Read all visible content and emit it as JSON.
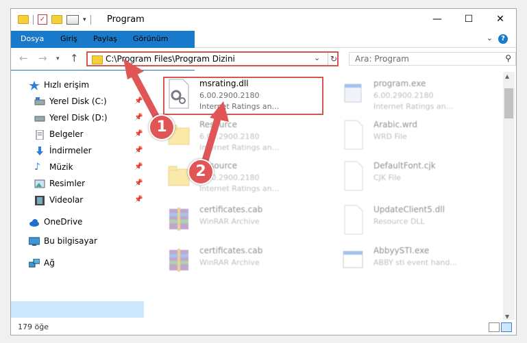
{
  "window": {
    "title": "Program"
  },
  "controls": {
    "minimize": "—",
    "maximize": "☐",
    "close": "✕"
  },
  "ribbon": {
    "tabs": [
      "Dosya",
      "Giriş",
      "Paylaş",
      "Görünüm"
    ]
  },
  "address": {
    "path": "C:\\Program Files\\Program Dizini"
  },
  "search": {
    "placeholder": "Ara: Program"
  },
  "sidebar": {
    "items": [
      {
        "label": "Hızlı erişim",
        "icon": "star-icon",
        "pinned": false
      },
      {
        "label": "Yerel Disk (C:)",
        "icon": "drive-icon",
        "pinned": true
      },
      {
        "label": "Yerel Disk (D:)",
        "icon": "drive-icon",
        "pinned": true
      },
      {
        "label": "Belgeler",
        "icon": "documents-icon",
        "pinned": true
      },
      {
        "label": "İndirmeler",
        "icon": "download-icon",
        "pinned": true
      },
      {
        "label": "Müzik",
        "icon": "music-icon",
        "pinned": true
      },
      {
        "label": "Resimler",
        "icon": "pictures-icon",
        "pinned": true
      },
      {
        "label": "Videolar",
        "icon": "video-icon",
        "pinned": true
      },
      {
        "label": "OneDrive",
        "icon": "cloud-icon",
        "pinned": false
      },
      {
        "label": "Bu bilgisayar",
        "icon": "computer-icon",
        "pinned": false,
        "selected": true
      },
      {
        "label": "Ağ",
        "icon": "network-icon",
        "pinned": false
      }
    ]
  },
  "files": [
    {
      "name": "msrating.dll",
      "line1": "6.00.2900.2180",
      "line2": "Internet Ratings an...",
      "icon": "dll-gear-icon",
      "highlight": true
    },
    {
      "name": "program.exe",
      "line1": "6.00.2900.2180",
      "line2": "Internet Ratings an...",
      "icon": "exe-icon"
    },
    {
      "name": "Resource",
      "line1": "6.00.2900.2180",
      "line2": "Internet Ratings an...",
      "icon": "folder-icon"
    },
    {
      "name": "Arabic.wrd",
      "line1": "WRD File",
      "line2": "",
      "icon": "blank-file-icon"
    },
    {
      "name": "Resource",
      "line1": "6.00.2900.2180",
      "line2": "Internet Ratings an...",
      "icon": "folder-icon"
    },
    {
      "name": "DefaultFont.cjk",
      "line1": "CJK File",
      "line2": "",
      "icon": "blank-file-icon"
    },
    {
      "name": "certificates.cab",
      "line1": "WinRAR Archive",
      "line2": "",
      "icon": "winrar-icon"
    },
    {
      "name": "UpdateClient5.dll",
      "line1": "Resource DLL",
      "line2": "",
      "icon": "blank-file-icon"
    },
    {
      "name": "certificates.cab",
      "line1": "WinRAR Archive",
      "line2": "",
      "icon": "winrar-icon"
    },
    {
      "name": "AbbyySTI.exe",
      "line1": "ABBY sti event hand...",
      "line2": "",
      "icon": "exe-window-icon"
    }
  ],
  "status": {
    "count": "179 öğe"
  },
  "annotations": {
    "step1": "1",
    "step2": "2"
  },
  "colors": {
    "accent": "#1979ca",
    "highlight": "#d9534f",
    "selection": "#cce8ff"
  }
}
